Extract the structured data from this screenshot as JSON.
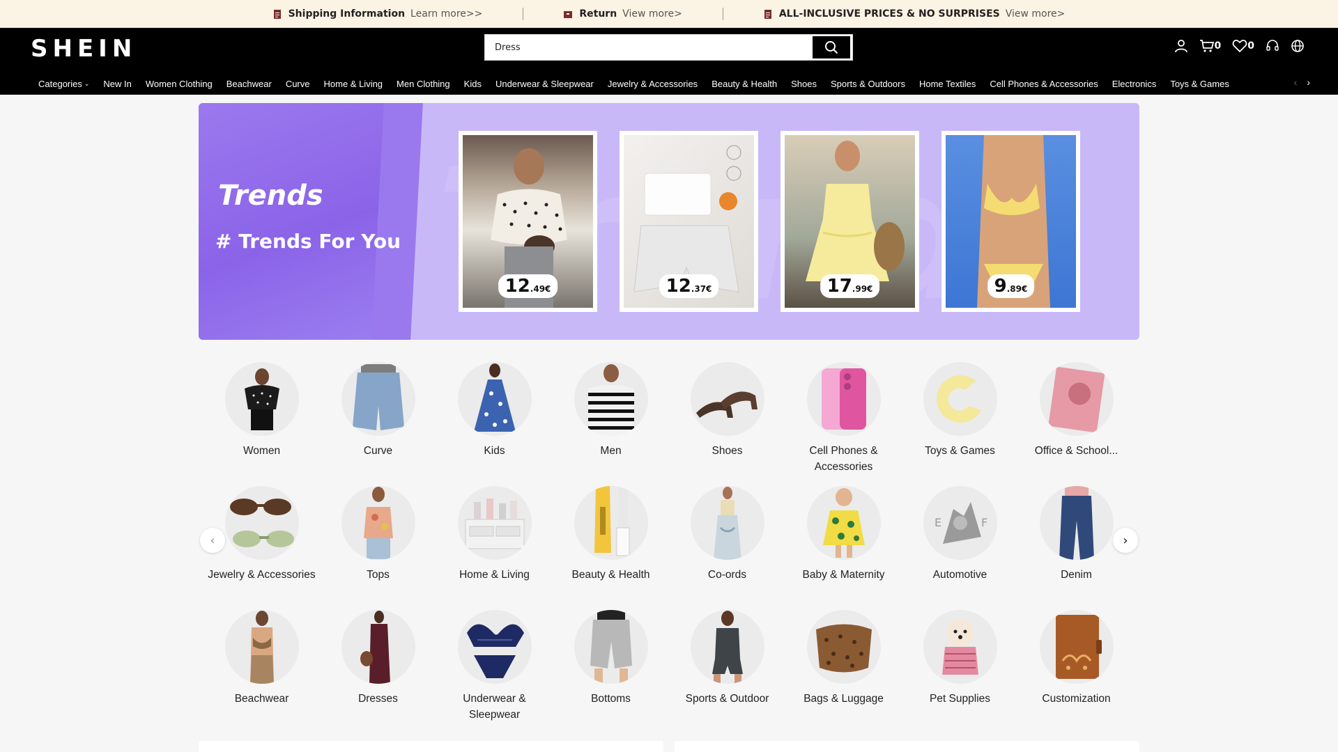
{
  "info_bar": [
    {
      "title": "Shipping Information",
      "link": "Learn more>>",
      "icon": "document-icon"
    },
    {
      "title": "Return",
      "link": "View more>",
      "icon": "return-box-icon"
    },
    {
      "title": "ALL-INCLUSIVE PRICES & NO SURPRISES",
      "link": "View more>",
      "icon": "document-icon"
    }
  ],
  "header": {
    "logo": "SHEIN",
    "search_value": "Dress",
    "cart_count": "0",
    "wishlist_count": "0"
  },
  "nav": {
    "items": [
      "Categories",
      "New In",
      "Women Clothing",
      "Beachwear",
      "Curve",
      "Home & Living",
      "Men Clothing",
      "Kids",
      "Underwear & Sleepwear",
      "Jewelry & Accessories",
      "Beauty & Health",
      "Shoes",
      "Sports & Outdoors",
      "Home Textiles",
      "Cell Phones & Accessories",
      "Electronics",
      "Toys & Games"
    ]
  },
  "banner": {
    "logo_text": "Trends",
    "title": "# Trends For You",
    "products": [
      {
        "price_int": "12",
        "price_dec": ".49€"
      },
      {
        "price_int": "12",
        "price_dec": ".37€"
      },
      {
        "price_int": "17",
        "price_dec": ".99€"
      },
      {
        "price_int": "9",
        "price_dec": ".89€"
      }
    ]
  },
  "categories": [
    "Women",
    "Curve",
    "Kids",
    "Men",
    "Shoes",
    "Cell Phones & Accessories",
    "Toys & Games",
    "Office & School...",
    "Jewelry & Accessories",
    "Tops",
    "Home & Living",
    "Beauty & Health",
    "Co-ords",
    "Baby & Maternity",
    "Automotive",
    "Denim",
    "Beachwear",
    "Dresses",
    "Underwear & Sleepwear",
    "Bottoms",
    "Sports & Outdoor",
    "Bags & Luggage",
    "Pet Supplies",
    "Customization"
  ]
}
